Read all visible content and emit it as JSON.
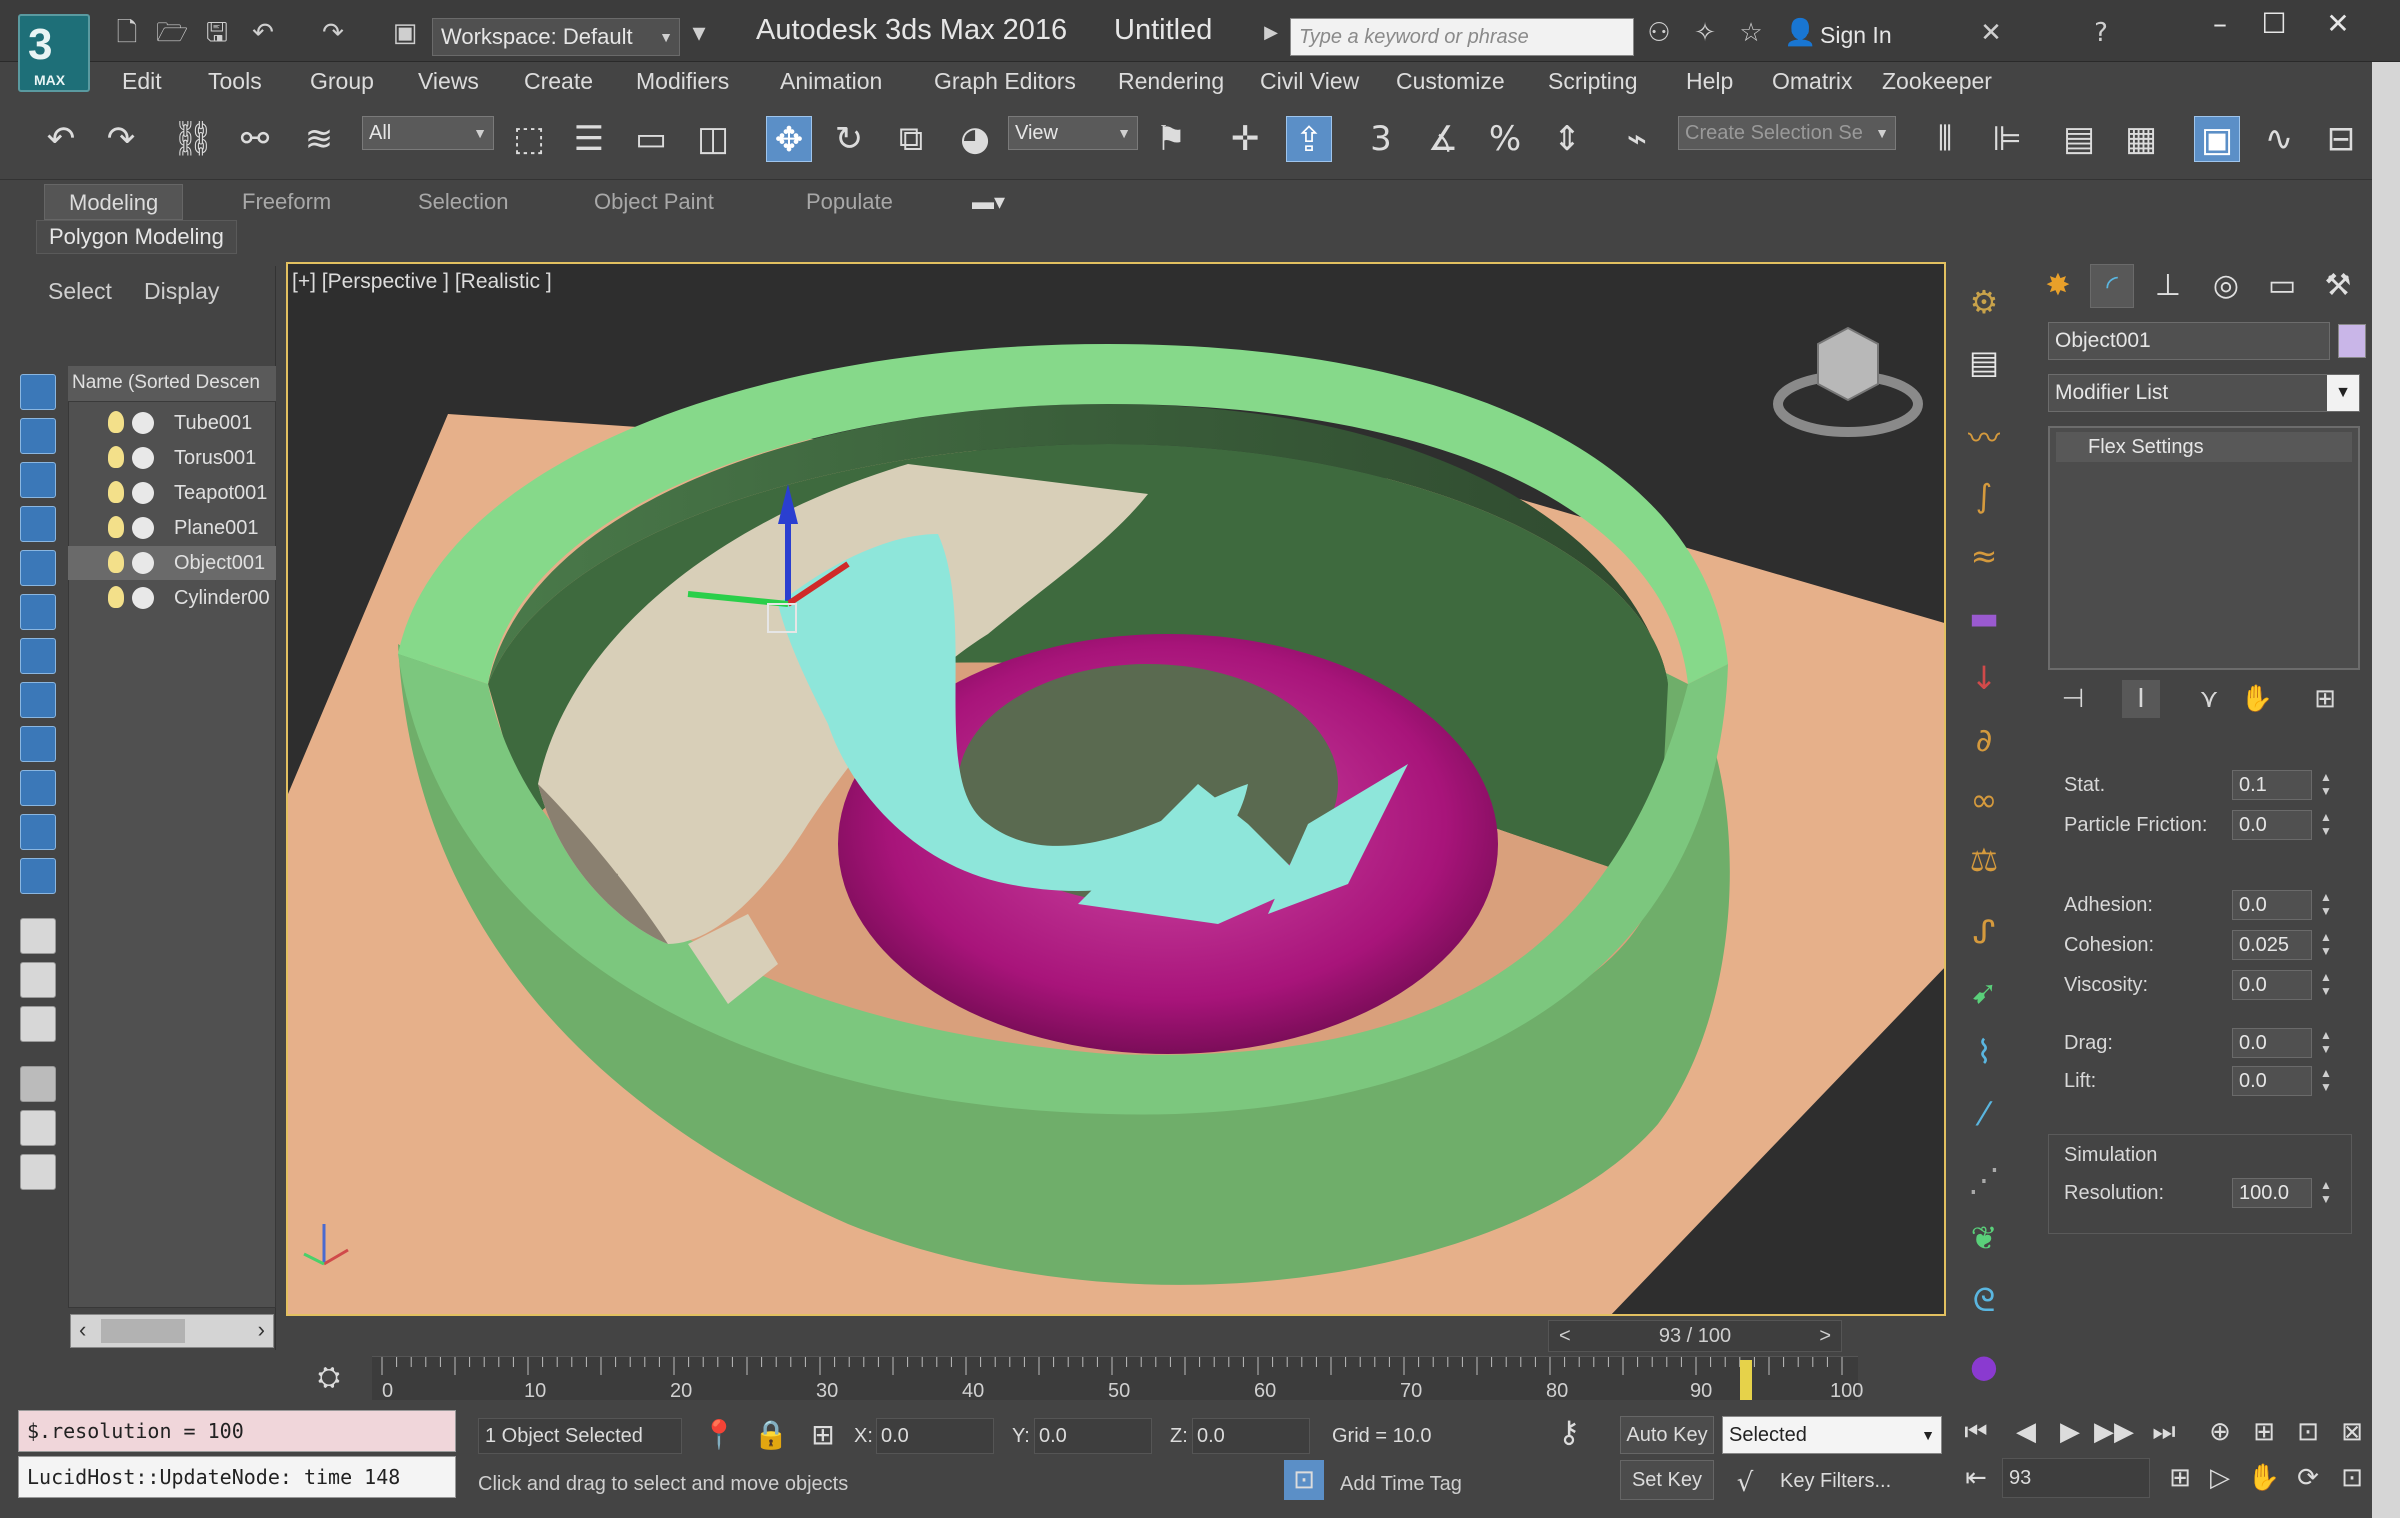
{
  "window": {
    "app_title": "Autodesk 3ds Max 2016",
    "doc_title": "Untitled",
    "workspace": "Workspace: Default",
    "search_placeholder": "Type a keyword or phrase",
    "sign_in": "Sign In",
    "logo_text": "MAX"
  },
  "menu": [
    "Edit",
    "Tools",
    "Group",
    "Views",
    "Create",
    "Modifiers",
    "Animation",
    "Graph Editors",
    "Rendering",
    "Civil View",
    "Customize",
    "Scripting",
    "Help",
    "Omatrix",
    "Zookeeper"
  ],
  "toolbar": {
    "selection_filter": "All",
    "ref_coord": "View",
    "named_selection": "Create Selection Se",
    "snap_3": "3"
  },
  "ribbon": {
    "tabs": [
      "Modeling",
      "Freeform",
      "Selection",
      "Object Paint",
      "Populate"
    ],
    "active_panel": "Polygon Modeling"
  },
  "explorer": {
    "tabs": [
      "Select",
      "Display"
    ],
    "column_header": "Name (Sorted Descen",
    "items": [
      {
        "name": "Tube001",
        "selected": false
      },
      {
        "name": "Torus001",
        "selected": false
      },
      {
        "name": "Teapot001",
        "selected": false
      },
      {
        "name": "Plane001",
        "selected": false
      },
      {
        "name": "Object001",
        "selected": true
      },
      {
        "name": "Cylinder00",
        "selected": false
      }
    ]
  },
  "viewport": {
    "label": "[+] [Perspective ] [Realistic ]"
  },
  "command_panel": {
    "object_name": "Object001",
    "object_color": "#c9b6e8",
    "modifier_list": "Modifier List",
    "stack_item": "Flex Settings",
    "params": [
      {
        "label": "Stat.",
        "value": "0.1"
      },
      {
        "label": "Particle Friction:",
        "value": "0.0"
      },
      {
        "label": "Adhesion:",
        "value": "0.0"
      },
      {
        "label": "Cohesion:",
        "value": "0.025"
      },
      {
        "label": "Viscosity:",
        "value": "0.0"
      },
      {
        "label": "Drag:",
        "value": "0.0"
      },
      {
        "label": "Lift:",
        "value": "0.0"
      }
    ],
    "simulation_title": "Simulation",
    "resolution_label": "Resolution:",
    "resolution_value": "100.0"
  },
  "timeline": {
    "slider_text": "93 / 100",
    "current_frame": 93,
    "ticks": [
      "0",
      "10",
      "20",
      "30",
      "40",
      "50",
      "60",
      "70",
      "80",
      "90",
      "100"
    ]
  },
  "status": {
    "maxscript_input": "$.resolution = 100",
    "maxscript_output": "LucidHost::UpdateNode: time 148",
    "selection_count": "1 Object Selected",
    "x_label": "X:",
    "x_value": "0.0",
    "y_label": "Y:",
    "y_value": "0.0",
    "z_label": "Z:",
    "z_value": "0.0",
    "grid": "Grid = 10.0",
    "prompt": "Click and drag to select and move objects",
    "add_time_tag": "Add Time Tag",
    "auto_key": "Auto Key",
    "set_key": "Set Key",
    "key_mode": "Selected",
    "key_filters": "Key Filters...",
    "frame": "93"
  },
  "colors": {
    "tube": "#86d98a",
    "torus": "#a8147a",
    "object": "#8ee6da",
    "plane": "#e6b08a",
    "cylinders": "#d8cfb8",
    "viewport_border": "#e2c060",
    "accent": "#5b8fc7"
  }
}
